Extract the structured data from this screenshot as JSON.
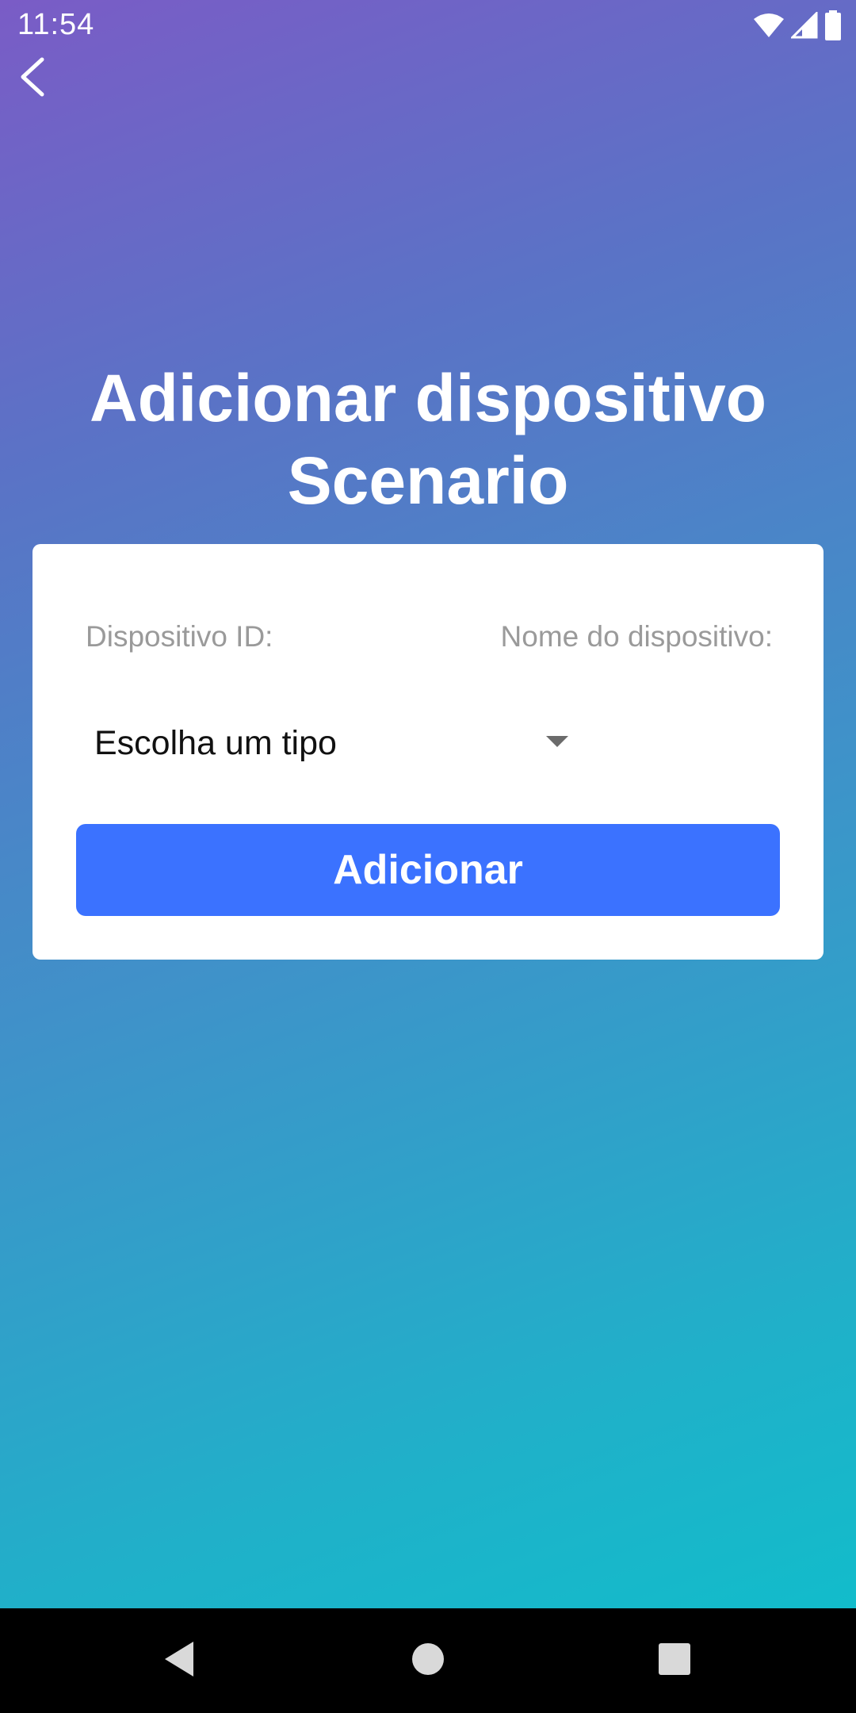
{
  "status_bar": {
    "time": "11:54",
    "icons": [
      "wifi-icon",
      "signal-icon",
      "battery-icon"
    ]
  },
  "header": {
    "back_icon": "chevron-left-icon",
    "title_line1": "Adicionar dispositivo",
    "title_line2": "Scenario"
  },
  "form": {
    "device_id_label": "Dispositivo ID:",
    "device_name_label": "Nome do dispositivo:",
    "type_select_value": "Escolha um tipo",
    "type_select_icon": "caret-down-icon",
    "submit_label": "Adicionar"
  },
  "nav_bar": {
    "icons": [
      "nav-back-icon",
      "nav-home-icon",
      "nav-recents-icon"
    ]
  },
  "colors": {
    "gradient_start": "#7a5cc6",
    "gradient_end": "#12bccb",
    "accent": "#3b72ff",
    "card": "#ffffff",
    "label_gray": "#9a9a9a"
  }
}
